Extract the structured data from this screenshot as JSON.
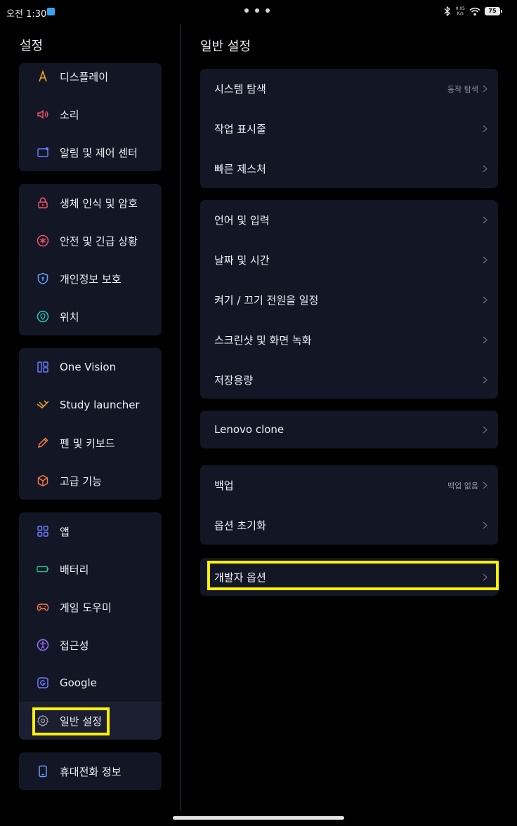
{
  "status": {
    "time": "오전 1:30",
    "net_speed_value": "0.05",
    "net_speed_unit": "K/s",
    "battery": "75"
  },
  "sidebar": {
    "title": "설정",
    "groups": [
      {
        "items": [
          {
            "label": "디스플레이",
            "icon": "display-icon",
            "color": "#f5a623"
          },
          {
            "label": "소리",
            "icon": "speaker-icon",
            "color": "#f0506e"
          },
          {
            "label": "알림 및 제어 센터",
            "icon": "notification-icon",
            "color": "#6c7cff"
          }
        ]
      },
      {
        "items": [
          {
            "label": "생체 인식 및 암호",
            "icon": "lock-icon",
            "color": "#f0506e"
          },
          {
            "label": "안전 및 긴급 상황",
            "icon": "emergency-icon",
            "color": "#f0506e"
          },
          {
            "label": "개인정보 보호",
            "icon": "shield-icon",
            "color": "#6c9cff"
          },
          {
            "label": "위치",
            "icon": "location-icon",
            "color": "#2bc4c4"
          }
        ]
      },
      {
        "items": [
          {
            "label": "One Vision",
            "icon": "one-vision-icon",
            "color": "#6c7cff"
          },
          {
            "label": "Study launcher",
            "icon": "study-icon",
            "color": "#f5a623"
          },
          {
            "label": "펜 및 키보드",
            "icon": "pen-icon",
            "color": "#ff7a45"
          },
          {
            "label": "고급 기능",
            "icon": "advanced-icon",
            "color": "#ff7a45"
          }
        ]
      },
      {
        "items": [
          {
            "label": "앱",
            "icon": "apps-icon",
            "color": "#6c7cff"
          },
          {
            "label": "배터리",
            "icon": "battery-icon",
            "color": "#2bc48a"
          },
          {
            "label": "게임 도우미",
            "icon": "gamepad-icon",
            "color": "#ff7a45"
          },
          {
            "label": "접근성",
            "icon": "accessibility-icon",
            "color": "#9b6cff"
          },
          {
            "label": "Google",
            "icon": "google-icon",
            "color": "#6c7cff"
          },
          {
            "label": "일반 설정",
            "icon": "gear-icon",
            "color": "#a0a4b0",
            "selected": true
          }
        ]
      },
      {
        "items": [
          {
            "label": "휴대전화 정보",
            "icon": "phone-icon",
            "color": "#6c9cff"
          }
        ]
      }
    ]
  },
  "main": {
    "title": "일반 설정",
    "groups": [
      {
        "rows": [
          {
            "label": "시스템 탐색",
            "value": "동작 탐색"
          },
          {
            "label": "작업 표시줄"
          },
          {
            "label": "빠른 제스처"
          }
        ]
      },
      {
        "rows": [
          {
            "label": "언어 및 입력"
          },
          {
            "label": "날짜 및 시간"
          },
          {
            "label": "켜기 / 끄기 전원을 일정"
          },
          {
            "label": "스크린샷 및 화면 녹화"
          },
          {
            "label": "저장용량"
          }
        ]
      },
      {
        "rows": [
          {
            "label": "Lenovo clone"
          }
        ]
      },
      {
        "rows": [
          {
            "label": "백업",
            "value": "백업 없음"
          },
          {
            "label": "옵션 초기화"
          }
        ]
      },
      {
        "rows": [
          {
            "label": "개발자 옵션",
            "highlighted": true
          }
        ]
      }
    ]
  },
  "colors": {
    "highlight": "#fff200",
    "card_bg": "#131625",
    "page_bg": "#000000"
  }
}
